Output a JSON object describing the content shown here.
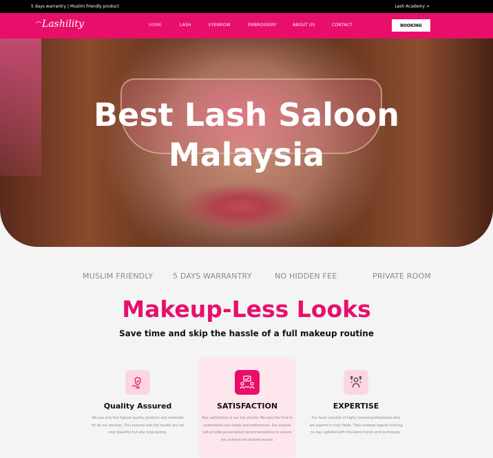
{
  "topbar": {
    "left_text": "5 days warrantry | Muslim friendly product",
    "right_text": "Lash Academy >"
  },
  "nav": {
    "logo": "Lashility",
    "items": [
      "HOME",
      "LASH",
      "EYEBROW",
      "EMBROIDERY",
      "ABOUT US",
      "CONTACT"
    ],
    "booking": "BOOKING"
  },
  "hero": {
    "title_line1": "Best Lash Saloon",
    "title_line2": "Malaysia"
  },
  "features": [
    "MUSLIM FRIENDLY",
    "5 DAYS WARRANTRY",
    "NO HIDDEN FEE",
    "PRIVATE ROOM"
  ],
  "section": {
    "title": "Makeup-Less Looks",
    "subtitle": "Save time and skip the hassle of a full makeup routine"
  },
  "cards": [
    {
      "title": "Quality Assured",
      "icon": "hand-heart-icon",
      "text": "We use only the highest quality products and materials for all our services. This ensures that the results are not only beautiful but also long-lasting."
    },
    {
      "title": "SATISFACTION",
      "icon": "satisfaction-icon",
      "text": "Your satisfaction is our top priority. We take the time to understand your needs and preferences. Our experts will provide personalized recommendations to ensure you achieve the desired results."
    },
    {
      "title": "EXPERTISE",
      "icon": "expertise-icon",
      "text": "Our team consists of highly trained professionals who are experts in their fields. They undergo regular training to stay updated with the latest trends and techniques."
    }
  ],
  "colors": {
    "brand_pink": "#e80f6b",
    "light_pink": "#fbd6e1",
    "card_highlight": "#fde6ec"
  }
}
